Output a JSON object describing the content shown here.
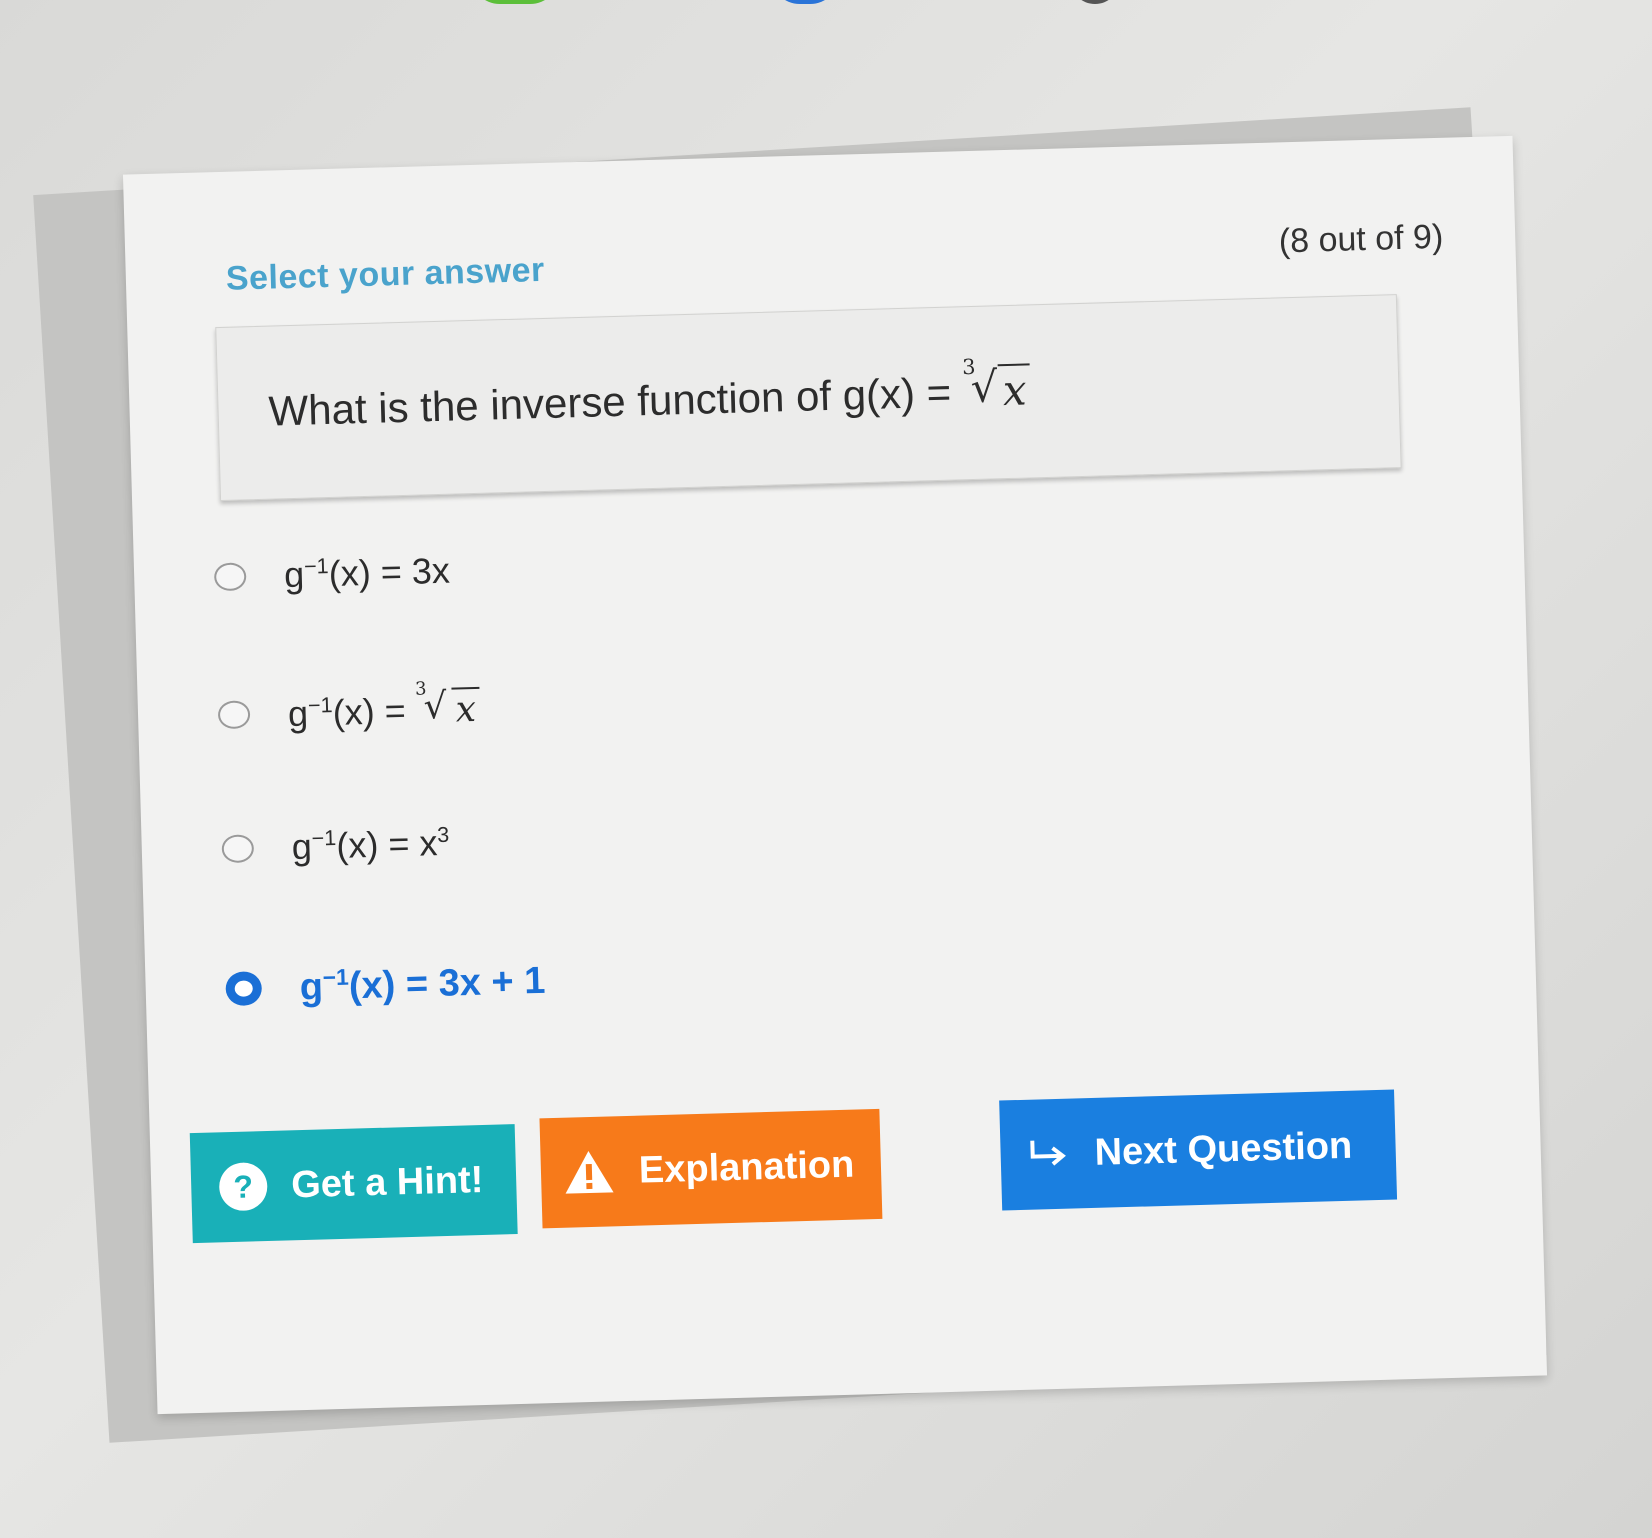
{
  "header": {
    "select_label": "Select your answer",
    "progress": "(8 out of 9)"
  },
  "question": {
    "prefix": "What is the inverse function of g(x) =",
    "root_index": "3",
    "radicand": "x"
  },
  "options": [
    {
      "label_prefix": "g",
      "label_sup": "−1",
      "label_rest": "(x) = 3x",
      "selected": false
    },
    {
      "label_prefix": "g",
      "label_sup": "−1",
      "label_rest": "(x) =",
      "root_index": "3",
      "radicand": "x",
      "selected": false
    },
    {
      "label_prefix": "g",
      "label_sup": "−1",
      "label_rest": "(x) = x",
      "label_sup2": "3",
      "selected": false
    },
    {
      "label_prefix": "g",
      "label_sup": "−1",
      "label_rest": "(x) = 3x + 1",
      "selected": true
    }
  ],
  "buttons": {
    "hint_label": "Get a Hint!",
    "hint_icon_text": "?",
    "explanation_label": "Explanation",
    "next_label": "Next Question"
  },
  "colors": {
    "accent_blue": "#1a7fe0",
    "hint_teal": "#19b0b8",
    "explain_orange": "#f77a1a",
    "heading_blue": "#4aa3cc"
  },
  "icons": {
    "hint": "question-circle-icon",
    "explanation": "warning-triangle-icon",
    "next": "return-arrow-icon"
  }
}
